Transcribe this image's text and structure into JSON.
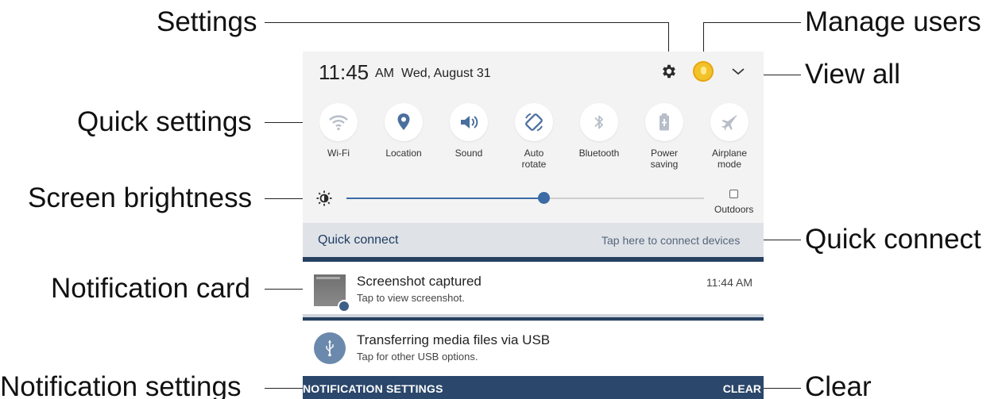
{
  "callouts": {
    "settings": "Settings",
    "manage_users": "Manage users",
    "view_all": "View all",
    "quick_settings": "Quick settings",
    "screen_brightness": "Screen brightness",
    "quick_connect": "Quick connect",
    "notification_card": "Notification card",
    "notification_settings": "Notification settings",
    "clear": "Clear"
  },
  "status": {
    "time": "11:45",
    "ampm": "AM",
    "date": "Wed, August 31",
    "icons": [
      "gear-icon",
      "user-avatar",
      "chevron-down-icon"
    ]
  },
  "quick_settings": [
    {
      "label1": "Wi-Fi",
      "label2": "",
      "icon": "wifi-icon",
      "active": false
    },
    {
      "label1": "Location",
      "label2": "",
      "icon": "location-icon",
      "active": true
    },
    {
      "label1": "Sound",
      "label2": "",
      "icon": "sound-icon",
      "active": true
    },
    {
      "label1": "Auto",
      "label2": "rotate",
      "icon": "auto-rotate-icon",
      "active": true
    },
    {
      "label1": "Bluetooth",
      "label2": "",
      "icon": "bluetooth-icon",
      "active": false
    },
    {
      "label1": "Power",
      "label2": "saving",
      "icon": "battery-icon",
      "active": false
    },
    {
      "label1": "Airplane",
      "label2": "mode",
      "icon": "airplane-icon",
      "active": false
    }
  ],
  "brightness": {
    "level": 0.55,
    "outdoors_label": "Outdoors",
    "outdoors_checked": false
  },
  "quick_connect": {
    "title": "Quick connect",
    "hint": "Tap here to connect devices"
  },
  "notifications": [
    {
      "title": "Screenshot captured",
      "subtitle": "Tap to view screenshot.",
      "time": "11:44 AM"
    },
    {
      "title": "Transferring media files via USB",
      "subtitle": "Tap for other USB options.",
      "time": ""
    }
  ],
  "footer": {
    "left": "NOTIFICATION SETTINGS",
    "right": "CLEAR"
  },
  "colors": {
    "accent": "#3c6ba5",
    "dark_bar": "#2b476b",
    "active_icon": "#4a6f9e",
    "inactive_icon": "#b7bec8"
  }
}
